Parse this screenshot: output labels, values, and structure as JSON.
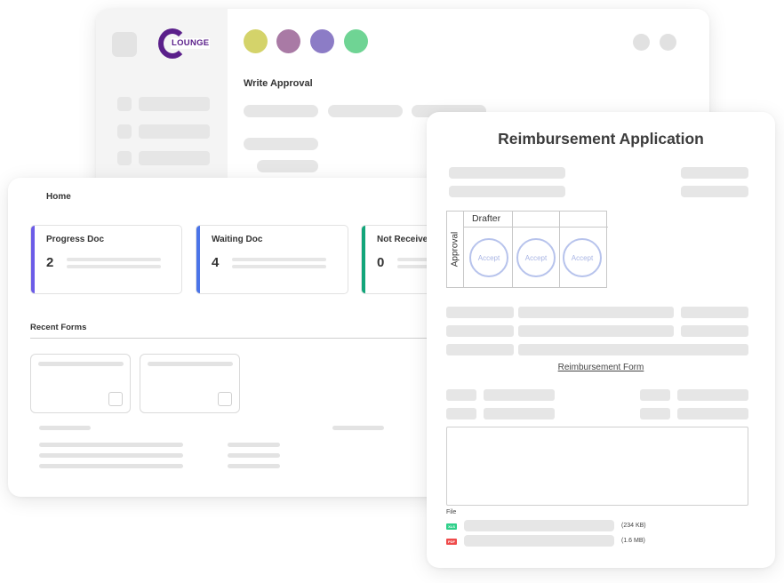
{
  "back_window": {
    "logo_text": "LOUNGE",
    "dots": [
      "#d4d36a",
      "#a97aa5",
      "#8c7cc6",
      "#6fd494"
    ],
    "title": "Write Approval"
  },
  "home": {
    "title": "Home",
    "stats": [
      {
        "label": "Progress Doc",
        "value": "2",
        "color": "#6c5ce7"
      },
      {
        "label": "Waiting Doc",
        "value": "4",
        "color": "#4a74e8"
      },
      {
        "label": "Not Received",
        "value": "0",
        "color": "#12a57a"
      }
    ],
    "recent_forms_label": "Recent Forms"
  },
  "reimbursement": {
    "title": "Reimbursement Application",
    "approval_label": "Approval",
    "drafter_label": "Drafter",
    "stamps": [
      "Accept",
      "Accept",
      "Accept"
    ],
    "form_link": "Reimbursement Form",
    "file_label": "File",
    "files": [
      {
        "type": "XLS",
        "size": "(234 KB)",
        "color": "#2fd08a"
      },
      {
        "type": "PDF",
        "size": "(1.6 MB)",
        "color": "#ef4b4b"
      }
    ]
  }
}
